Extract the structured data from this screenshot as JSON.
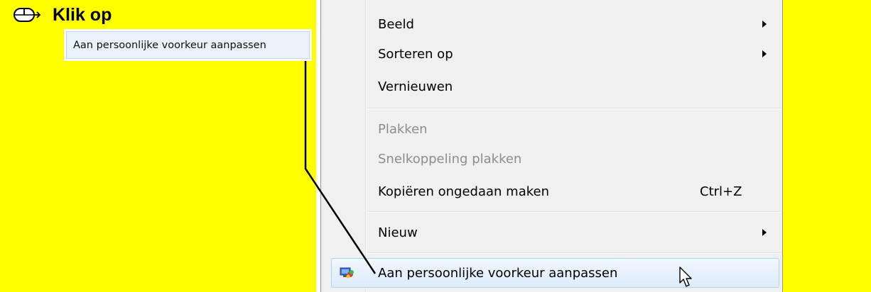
{
  "instruction": {
    "icon": "mouse-click-icon",
    "heading": "Klik op",
    "callout": "Aan persoonlijke voorkeur aanpassen"
  },
  "context_menu": {
    "items": [
      {
        "label": "Beeld",
        "has_submenu": true,
        "enabled": true
      },
      {
        "label": "Sorteren op",
        "has_submenu": true,
        "enabled": true
      },
      {
        "label": "Vernieuwen",
        "has_submenu": false,
        "enabled": true
      },
      {
        "label": "Plakken",
        "has_submenu": false,
        "enabled": false
      },
      {
        "label": "Snelkoppeling plakken",
        "has_submenu": false,
        "enabled": false
      },
      {
        "label": "Kopiëren ongedaan maken",
        "shortcut": "Ctrl+Z",
        "has_submenu": false,
        "enabled": true
      },
      {
        "label": "Nieuw",
        "has_submenu": true,
        "enabled": true
      },
      {
        "label": "Aan persoonlijke voorkeur aanpassen",
        "icon": "personalize-icon",
        "highlighted": true,
        "enabled": true
      }
    ]
  },
  "colors": {
    "background": "#ffff00",
    "menu_background": "#f0f0f0",
    "disabled_text": "#8d8d8d",
    "highlight_border": "#a8d8eb"
  }
}
